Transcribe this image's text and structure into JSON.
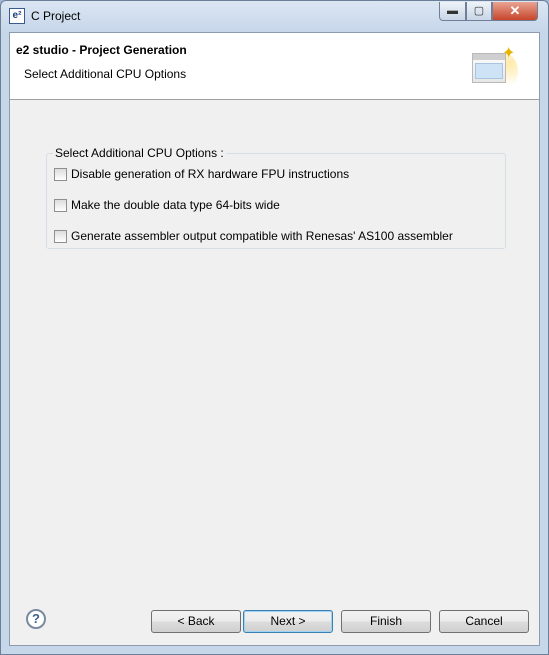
{
  "window": {
    "title": "C Project",
    "app_icon_text": "e²",
    "controls": {
      "minimize": "▬",
      "maximize": "▢",
      "close": "✕"
    }
  },
  "header": {
    "title": "e2 studio - Project Generation",
    "subtitle": "Select Additional CPU Options",
    "graphic_icon": "wizard-banner-icon"
  },
  "group": {
    "label": "Select Additional CPU Options :",
    "options": [
      {
        "label": "Disable generation of RX hardware FPU instructions",
        "checked": false
      },
      {
        "label": "Make the double data type 64-bits wide",
        "checked": false
      },
      {
        "label": "Generate assembler output compatible with Renesas' AS100 assembler",
        "checked": false
      }
    ]
  },
  "footer": {
    "help_symbol": "?",
    "back_label": "< Back",
    "next_label": "Next >",
    "finish_label": "Finish",
    "cancel_label": "Cancel"
  }
}
